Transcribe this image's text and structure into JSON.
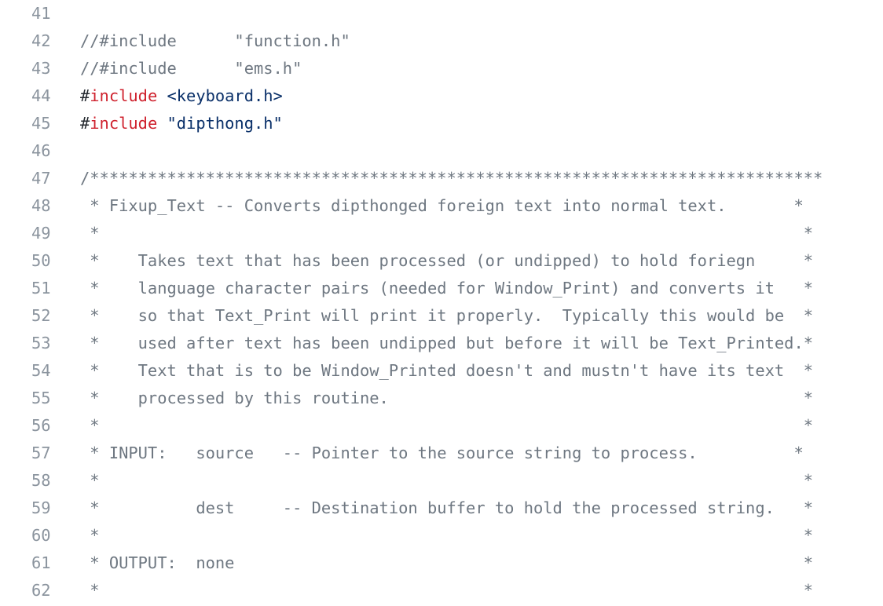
{
  "colors": {
    "background": "#ffffff",
    "line_number": "#8b949e",
    "comment": "#6e7781",
    "plain": "#24292f",
    "keyword": "#cf222e",
    "string": "#0a3069"
  },
  "lines": [
    {
      "number": "41",
      "tokens": []
    },
    {
      "number": "42",
      "tokens": [
        {
          "type": "comment",
          "text": "//#include      \"function.h\""
        }
      ]
    },
    {
      "number": "43",
      "tokens": [
        {
          "type": "comment",
          "text": "//#include      \"ems.h\""
        }
      ]
    },
    {
      "number": "44",
      "tokens": [
        {
          "type": "plain",
          "text": "#"
        },
        {
          "type": "keyword",
          "text": "include"
        },
        {
          "type": "plain",
          "text": " "
        },
        {
          "type": "string",
          "text": "<keyboard.h>"
        }
      ]
    },
    {
      "number": "45",
      "tokens": [
        {
          "type": "plain",
          "text": "#"
        },
        {
          "type": "keyword",
          "text": "include"
        },
        {
          "type": "plain",
          "text": " "
        },
        {
          "type": "string",
          "text": "\"dipthong.h\""
        }
      ]
    },
    {
      "number": "46",
      "tokens": []
    },
    {
      "number": "47",
      "tokens": [
        {
          "type": "comment",
          "text": "/****************************************************************************"
        }
      ]
    },
    {
      "number": "48",
      "tokens": [
        {
          "type": "comment",
          "text": " * Fixup_Text -- Converts dipthonged foreign text into normal text.       *"
        }
      ]
    },
    {
      "number": "49",
      "tokens": [
        {
          "type": "comment",
          "text": " *                                                                         *"
        }
      ]
    },
    {
      "number": "50",
      "tokens": [
        {
          "type": "comment",
          "text": " *    Takes text that has been processed (or undipped) to hold foriegn     *"
        }
      ]
    },
    {
      "number": "51",
      "tokens": [
        {
          "type": "comment",
          "text": " *    language character pairs (needed for Window_Print) and converts it   *"
        }
      ]
    },
    {
      "number": "52",
      "tokens": [
        {
          "type": "comment",
          "text": " *    so that Text_Print will print it properly.  Typically this would be  *"
        }
      ]
    },
    {
      "number": "53",
      "tokens": [
        {
          "type": "comment",
          "text": " *    used after text has been undipped but before it will be Text_Printed.*"
        }
      ]
    },
    {
      "number": "54",
      "tokens": [
        {
          "type": "comment",
          "text": " *    Text that is to be Window_Printed doesn't and mustn't have its text  *"
        }
      ]
    },
    {
      "number": "55",
      "tokens": [
        {
          "type": "comment",
          "text": " *    processed by this routine.                                           *"
        }
      ]
    },
    {
      "number": "56",
      "tokens": [
        {
          "type": "comment",
          "text": " *                                                                         *"
        }
      ]
    },
    {
      "number": "57",
      "tokens": [
        {
          "type": "comment",
          "text": " * INPUT:   source   -- Pointer to the source string to process.          *"
        }
      ]
    },
    {
      "number": "58",
      "tokens": [
        {
          "type": "comment",
          "text": " *                                                                         *"
        }
      ]
    },
    {
      "number": "59",
      "tokens": [
        {
          "type": "comment",
          "text": " *          dest     -- Destination buffer to hold the processed string.   *"
        }
      ]
    },
    {
      "number": "60",
      "tokens": [
        {
          "type": "comment",
          "text": " *                                                                         *"
        }
      ]
    },
    {
      "number": "61",
      "tokens": [
        {
          "type": "comment",
          "text": " * OUTPUT:  none                                                           *"
        }
      ]
    },
    {
      "number": "62",
      "tokens": [
        {
          "type": "comment",
          "text": " *                                                                         *"
        }
      ]
    }
  ]
}
